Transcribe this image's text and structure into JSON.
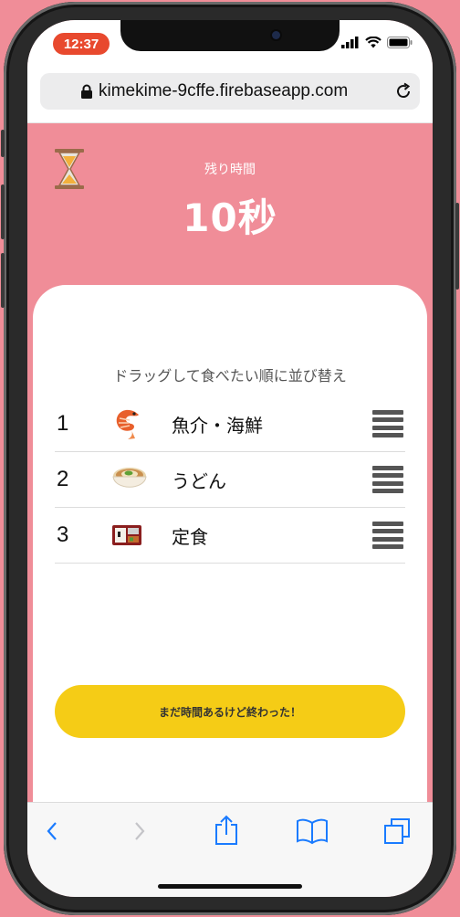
{
  "status_bar": {
    "time": "12:37"
  },
  "browser": {
    "url": "kimekime-9cffe.firebaseapp.com"
  },
  "timer": {
    "label": "残り時間",
    "value": "10秒"
  },
  "instruction": "ドラッグして食べたい順に並び替え",
  "ranking": [
    {
      "rank": "1",
      "label": "魚介・海鮮",
      "icon": "shrimp-icon"
    },
    {
      "rank": "2",
      "label": "うどん",
      "icon": "udon-bowl-icon"
    },
    {
      "rank": "3",
      "label": "定食",
      "icon": "bento-icon"
    }
  ],
  "finish_button": {
    "label": "まだ時間あるけど終わった！"
  },
  "colors": {
    "background": "#f08d98",
    "button": "#f5cc16",
    "toolbar_accent": "#1a7bff"
  }
}
